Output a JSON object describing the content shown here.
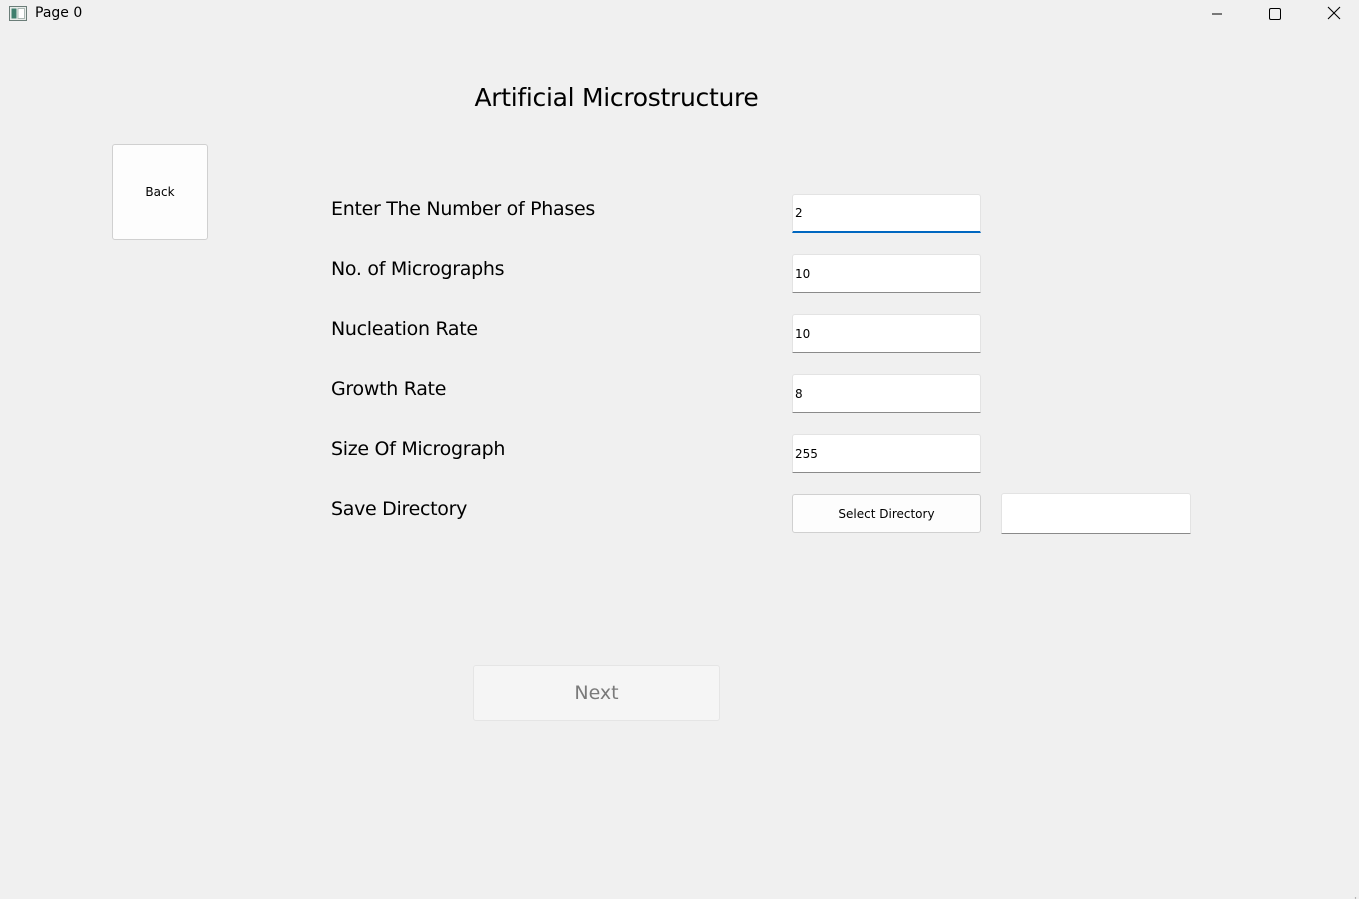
{
  "window": {
    "title": "Page 0",
    "icon": "app-window-icon",
    "controls": {
      "minimize_icon": "minimize-icon",
      "maximize_icon": "maximize-icon",
      "close_icon": "close-icon"
    }
  },
  "header": {
    "title": "Artificial Microstructure"
  },
  "back_button": {
    "label": "Back"
  },
  "form": {
    "fields": [
      {
        "label": "Enter The Number of Phases",
        "value": "2",
        "focused": true
      },
      {
        "label": "No. of Micrographs",
        "value": "10"
      },
      {
        "label": "Nucleation Rate",
        "value": "10"
      },
      {
        "label": "Growth Rate",
        "value": "8"
      },
      {
        "label": "Size Of Micrograph",
        "value": "255"
      }
    ],
    "save_directory": {
      "label": "Save Directory",
      "button_label": "Select Directory",
      "path_value": ""
    }
  },
  "next_button": {
    "label": "Next",
    "enabled": false
  },
  "colors": {
    "background": "#f0f0f0",
    "focus_accent": "#0067c0",
    "disabled_text": "#7a7a7a"
  }
}
